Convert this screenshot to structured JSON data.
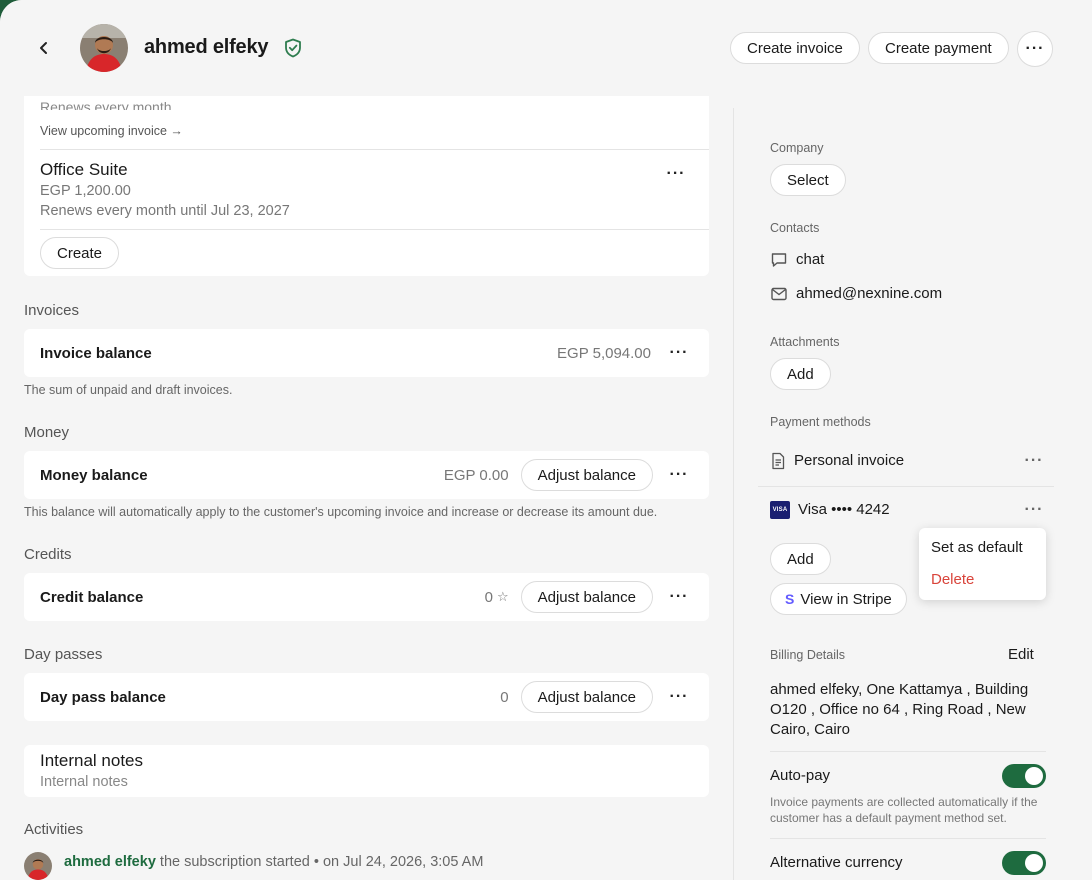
{
  "header": {
    "customer_name": "ahmed elfeky",
    "create_invoice": "Create invoice",
    "create_payment": "Create payment"
  },
  "subscriptions": {
    "prev_renew_text": "Renews every month",
    "view_upcoming": "View upcoming invoice →",
    "item_name": "Office Suite",
    "item_price": "EGP 1,200.00",
    "item_renew": "Renews every month until Jul 23, 2027",
    "create_label": "Create"
  },
  "invoices": {
    "title": "Invoices",
    "label": "Invoice balance",
    "value": "EGP 5,094.00",
    "helper": "The sum of unpaid and draft invoices."
  },
  "money": {
    "title": "Money",
    "label": "Money balance",
    "value": "EGP 0.00",
    "adjust": "Adjust balance",
    "helper": "This balance will automatically apply to the customer's upcoming invoice and increase or decrease its amount due."
  },
  "credits": {
    "title": "Credits",
    "label": "Credit balance",
    "value": "0",
    "adjust": "Adjust balance"
  },
  "day_passes": {
    "title": "Day passes",
    "label": "Day pass balance",
    "value": "0",
    "adjust": "Adjust balance"
  },
  "notes": {
    "title": "Internal notes",
    "placeholder": "Internal notes"
  },
  "activities": {
    "title": "Activities",
    "items": [
      {
        "user": "ahmed elfeky",
        "text": "the subscription started",
        "date": "on Jul 24, 2026, 3:05 AM"
      }
    ]
  },
  "sidebar": {
    "company_label": "Company",
    "company_select": "Select",
    "contacts_label": "Contacts",
    "contact_chat": "chat",
    "contact_email": "ahmed@nexnine.com",
    "attachments_label": "Attachments",
    "attachments_add": "Add",
    "payment_methods_label": "Payment methods",
    "pm_personal_invoice": "Personal invoice",
    "pm_card_brand": "VISA",
    "pm_card": "Visa •••• 4242",
    "pm_add": "Add",
    "view_in_stripe": "View in Stripe",
    "billing_label": "Billing Details",
    "billing_edit": "Edit",
    "billing_address": "ahmed elfeky, One Kattamya , Building O120 , Office no 64 , Ring Road , New Cairo, Cairo",
    "autopay_label": "Auto-pay",
    "autopay_helper": "Invoice payments are collected automatically if the customer has a default payment method set.",
    "alt_currency_label": "Alternative currency"
  },
  "context_menu": {
    "set_default": "Set as default",
    "delete": "Delete"
  },
  "colors": {
    "brand_green": "#1e6b3f",
    "danger": "#d9443b",
    "stripe_purple": "#635bff",
    "visa_blue": "#1a1f71"
  }
}
